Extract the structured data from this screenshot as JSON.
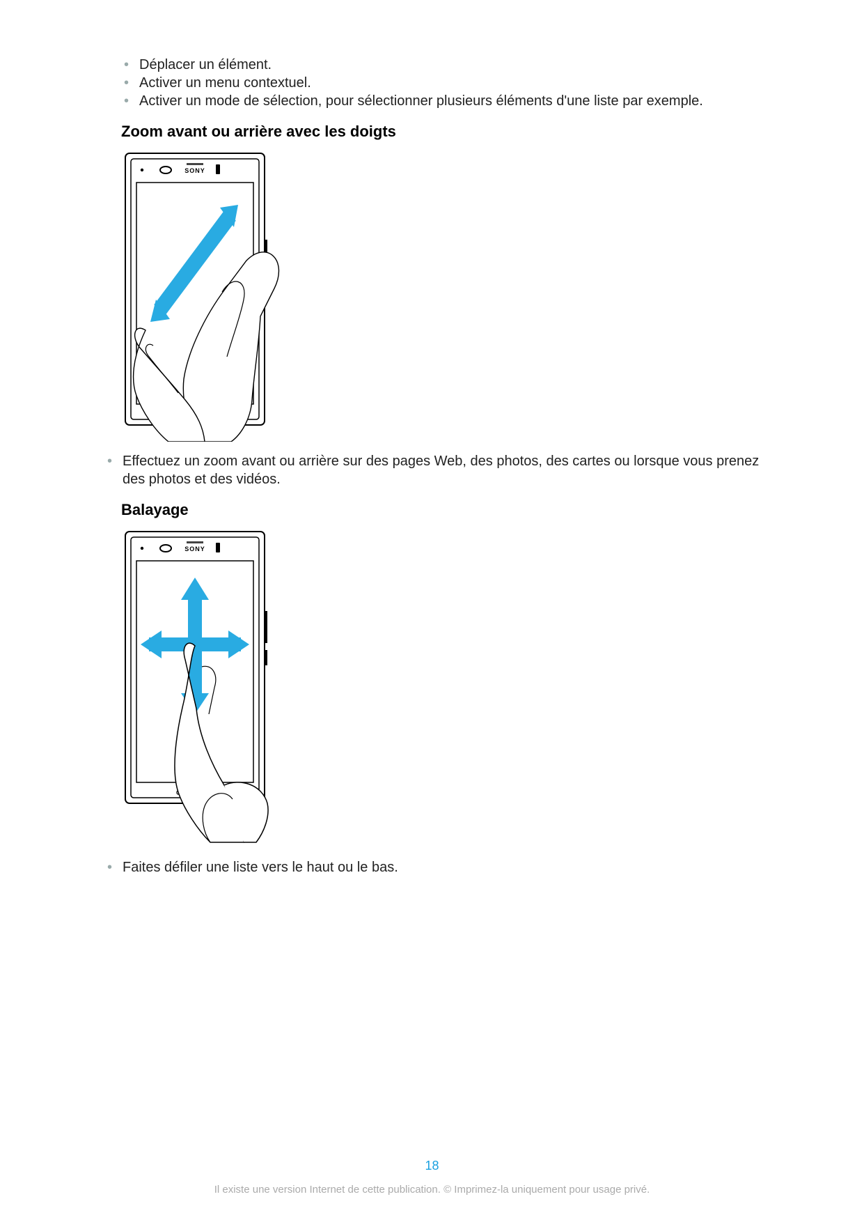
{
  "bullets_top": [
    "Déplacer un élément.",
    "Activer un menu contextuel.",
    "Activer un mode de sélection, pour sélectionner plusieurs éléments d'une liste par exemple."
  ],
  "section1": {
    "heading": "Zoom avant ou arrière avec les doigts",
    "bullet": "Effectuez un zoom avant ou arrière sur des pages Web, des photos, des cartes ou lorsque vous prenez des photos et des vidéos."
  },
  "section2": {
    "heading": "Balayage",
    "bullet": "Faites défiler une liste vers le haut ou le bas."
  },
  "phone_brand": "SONY",
  "page_number": "18",
  "copyright": "Il existe une version Internet de cette publication. © Imprimez-la uniquement pour usage privé."
}
